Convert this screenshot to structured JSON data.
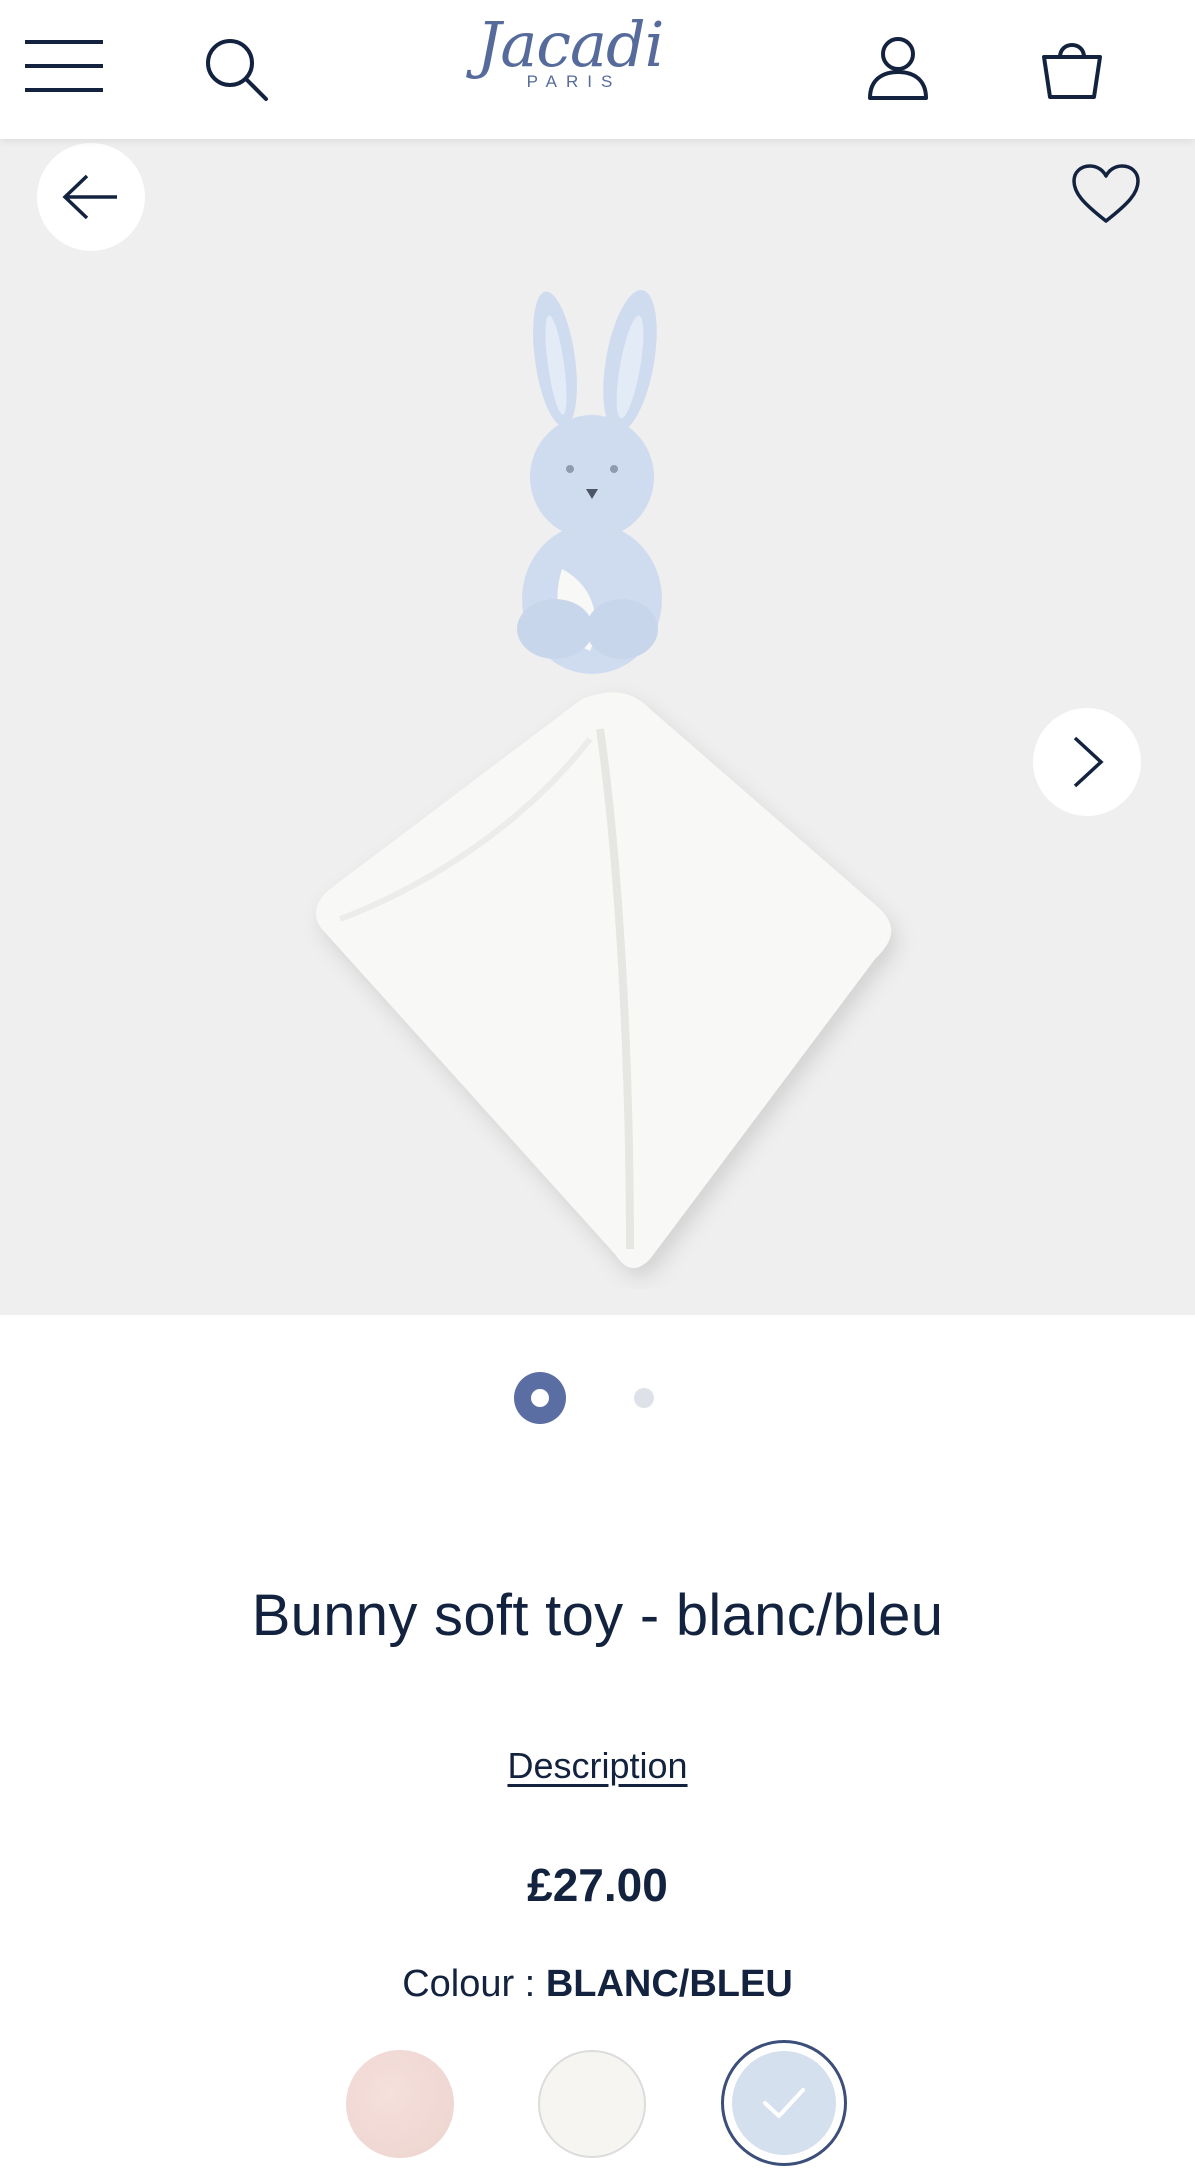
{
  "header": {
    "logo": {
      "word": "Jacadi",
      "sub": "PARIS"
    },
    "icons": {
      "menu": "hamburger-menu-icon",
      "search": "search-icon",
      "account": "user-account-icon",
      "bag": "shopping-bag-icon"
    }
  },
  "gallery": {
    "back_icon": "arrow-left-icon",
    "favorite_icon": "heart-outline-icon",
    "next_icon": "chevron-right-icon",
    "pager": {
      "total": 2,
      "active": 1
    }
  },
  "product": {
    "title": "Bunny soft toy - blanc/bleu",
    "description_link": "Description",
    "price": "£27.00",
    "colour_label": "Colour :",
    "colour_value": "BLANC/BLEU",
    "swatches": [
      {
        "name": "pink",
        "color": "#f0d8d3",
        "selected": false
      },
      {
        "name": "white",
        "color": "#f6f5f2",
        "selected": false
      },
      {
        "name": "blanc-bleu",
        "color": "#d5e0ee",
        "selected": true
      }
    ]
  },
  "colors": {
    "brand": "#566b9c",
    "text": "#13233f",
    "gallery_bg": "#efefef"
  }
}
